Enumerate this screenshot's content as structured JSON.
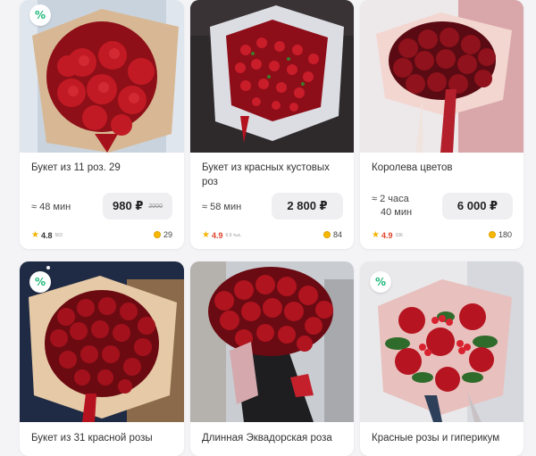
{
  "promo_label": "%",
  "currency": "₽",
  "cards": [
    {
      "title": "Букет из 11 роз. 29",
      "eta_line1": "≈ 48 мин",
      "eta_line2": "",
      "price": "980 ₽",
      "old_price": "2000",
      "rating": "4.8",
      "rating_count": "563",
      "bonus": "29"
    },
    {
      "title": "Букет из красных кустовых роз",
      "eta_line1": "≈ 58 мин",
      "eta_line2": "",
      "price": "2 800 ₽",
      "old_price": "",
      "rating": "4.9",
      "rating_count": "6,9 тыс.",
      "bonus": "84"
    },
    {
      "title": "Королева цветов",
      "eta_line1": "≈ 2 часа",
      "eta_line2": "40 мин",
      "price": "6 000 ₽",
      "old_price": "",
      "rating": "4.9",
      "rating_count": "336",
      "bonus": "180"
    },
    {
      "title": "Букет из 31 красной розы"
    },
    {
      "title": "Длинная Эквадорская роза"
    },
    {
      "title": "Красные розы и гиперикум"
    }
  ],
  "colors": {
    "accent_green": "#1fb87a",
    "star": "#f4b400",
    "rating_red": "#e0442b",
    "coin": "#f6b800"
  }
}
